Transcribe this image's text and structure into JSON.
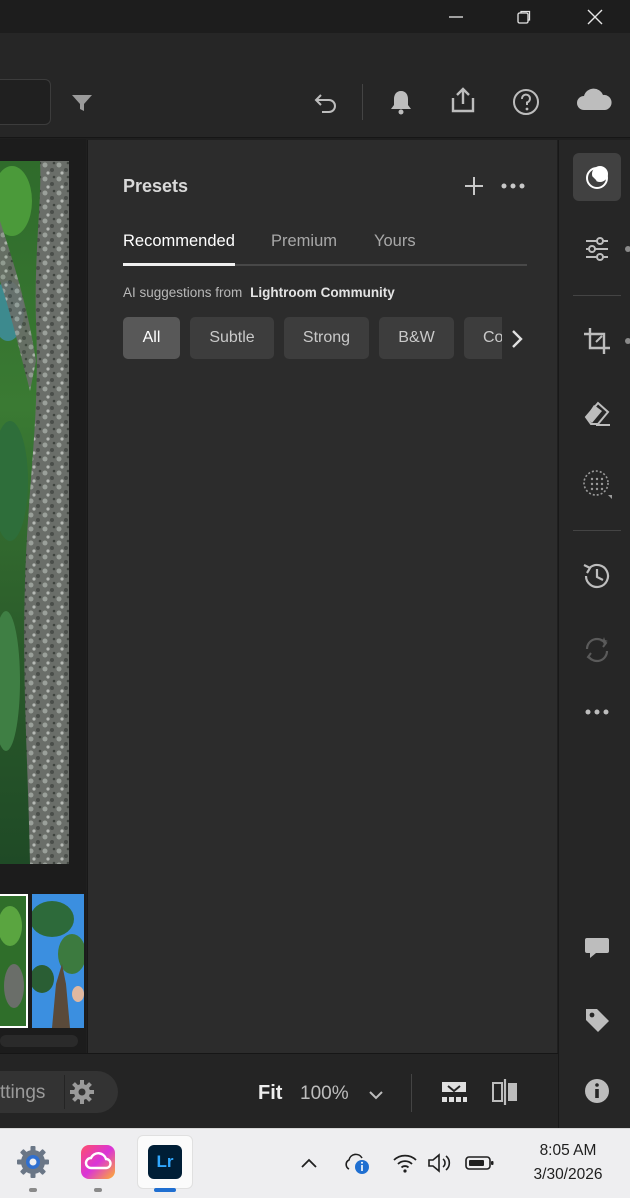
{
  "presets": {
    "title": "Presets",
    "tabs": [
      "Recommended",
      "Premium",
      "Yours"
    ],
    "ai_prefix": "AI suggestions from",
    "ai_source": "Lightroom Community",
    "chips": [
      "All",
      "Subtle",
      "Strong",
      "B&W",
      "Co"
    ]
  },
  "bottom": {
    "settings_label": "ttings",
    "fit_label": "Fit",
    "zoom_label": "100%"
  },
  "taskbar": {
    "lr_label": "Lr",
    "time": "8:05 AM",
    "date": "3/30/2026"
  },
  "icons": {
    "window_minimize": "minimize-icon",
    "window_restore": "restore-icon",
    "window_close": "close-icon",
    "filter": "filter-icon",
    "undo": "undo-icon",
    "notifications": "bell-icon",
    "share": "share-icon",
    "help": "help-icon",
    "cloud": "cloud-icon"
  },
  "colors": {
    "panel_bg": "#2c2c2c",
    "accent_lr": "#31a8ff",
    "taskbar_bg": "#eeeef0"
  }
}
